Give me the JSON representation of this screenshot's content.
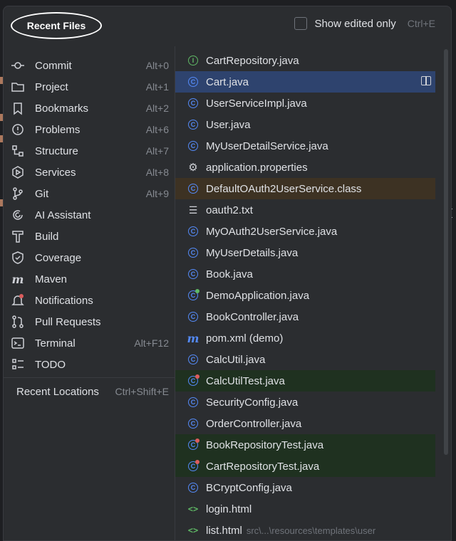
{
  "popup": {
    "title": "Recent Files",
    "show_edited_label": "Show edited only",
    "show_edited_shortcut": "Ctrl+E"
  },
  "tools": [
    {
      "label": "Commit",
      "key": "Alt+0",
      "icon": "commit-icon"
    },
    {
      "label": "Project",
      "key": "Alt+1",
      "icon": "folder-icon"
    },
    {
      "label": "Bookmarks",
      "key": "Alt+2",
      "icon": "bookmark-icon"
    },
    {
      "label": "Problems",
      "key": "Alt+6",
      "icon": "problems-icon"
    },
    {
      "label": "Structure",
      "key": "Alt+7",
      "icon": "structure-icon"
    },
    {
      "label": "Services",
      "key": "Alt+8",
      "icon": "services-icon"
    },
    {
      "label": "Git",
      "key": "Alt+9",
      "icon": "git-icon"
    },
    {
      "label": "AI Assistant",
      "key": "",
      "icon": "ai-assistant-icon"
    },
    {
      "label": "Build",
      "key": "",
      "icon": "build-hammer-icon"
    },
    {
      "label": "Coverage",
      "key": "",
      "icon": "coverage-shield-icon"
    },
    {
      "label": "Maven",
      "key": "",
      "icon": "maven-icon"
    },
    {
      "label": "Notifications",
      "key": "",
      "icon": "notification-bell-icon"
    },
    {
      "label": "Pull Requests",
      "key": "",
      "icon": "pull-request-icon"
    },
    {
      "label": "Terminal",
      "key": "Alt+F12",
      "icon": "terminal-icon"
    },
    {
      "label": "TODO",
      "key": "",
      "icon": "todo-icon"
    }
  ],
  "recent_locations": {
    "label": "Recent Locations",
    "key": "Ctrl+Shift+E"
  },
  "files": [
    {
      "name": "CartRepository.java",
      "path": "",
      "icon": "interface",
      "state": ""
    },
    {
      "name": "Cart.java",
      "path": "",
      "icon": "class",
      "state": "selected"
    },
    {
      "name": "UserServiceImpl.java",
      "path": "",
      "icon": "class",
      "state": ""
    },
    {
      "name": "User.java",
      "path": "",
      "icon": "class",
      "state": ""
    },
    {
      "name": "MyUserDetailService.java",
      "path": "",
      "icon": "class",
      "state": ""
    },
    {
      "name": "application.properties",
      "path": "",
      "icon": "gear",
      "state": ""
    },
    {
      "name": "DefaultOAuth2UserService.class",
      "path": "",
      "icon": "class",
      "state": "modified"
    },
    {
      "name": "oauth2.txt",
      "path": "",
      "icon": "text",
      "state": ""
    },
    {
      "name": "MyOAuth2UserService.java",
      "path": "",
      "icon": "class",
      "state": ""
    },
    {
      "name": "MyUserDetails.java",
      "path": "",
      "icon": "class",
      "state": ""
    },
    {
      "name": "Book.java",
      "path": "",
      "icon": "class",
      "state": ""
    },
    {
      "name": "DemoApplication.java",
      "path": "",
      "icon": "class-run",
      "state": ""
    },
    {
      "name": "BookController.java",
      "path": "",
      "icon": "class",
      "state": ""
    },
    {
      "name": "pom.xml (demo)",
      "path": "",
      "icon": "maven",
      "state": ""
    },
    {
      "name": "CalcUtil.java",
      "path": "",
      "icon": "class",
      "state": ""
    },
    {
      "name": "CalcUtilTest.java",
      "path": "",
      "icon": "class-test",
      "state": "test"
    },
    {
      "name": "SecurityConfig.java",
      "path": "",
      "icon": "class",
      "state": ""
    },
    {
      "name": "OrderController.java",
      "path": "",
      "icon": "class",
      "state": ""
    },
    {
      "name": "BookRepositoryTest.java",
      "path": "",
      "icon": "class-test",
      "state": "test"
    },
    {
      "name": "CartRepositoryTest.java",
      "path": "",
      "icon": "class-test",
      "state": "test"
    },
    {
      "name": "BCryptConfig.java",
      "path": "",
      "icon": "class",
      "state": ""
    },
    {
      "name": "login.html",
      "path": "",
      "icon": "html",
      "state": ""
    },
    {
      "name": "list.html",
      "path": "src\\...\\resources\\templates\\user",
      "icon": "html",
      "state": ""
    }
  ]
}
